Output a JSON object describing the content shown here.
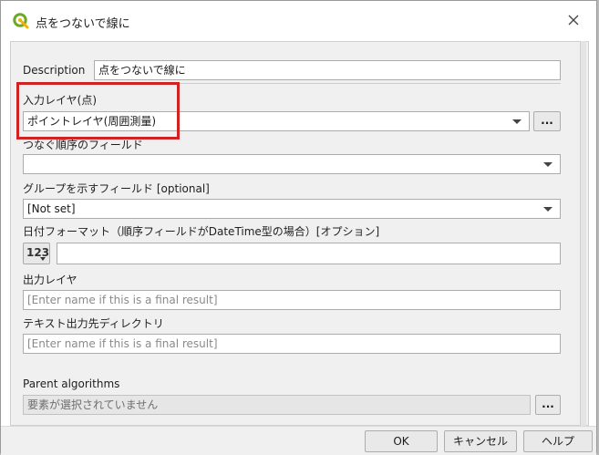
{
  "window": {
    "title": "点をつないで線に",
    "icon": "qgis-logo-icon",
    "close_icon": "close-icon"
  },
  "form": {
    "description": {
      "label": "Description",
      "value": "点をつないで線に"
    },
    "input_layer": {
      "label": "入力レイヤ(点)",
      "value": "ポイントレイヤ(周囲測量)",
      "browse": "..."
    },
    "order_field": {
      "label": "つなぐ順序のフィールド",
      "value": ""
    },
    "group_field": {
      "label": "グループを示すフィールド [optional]",
      "value": "[Not set]"
    },
    "date_format": {
      "label": "日付フォーマット（順序フィールドがDateTime型の場合）[オプション]",
      "value": "",
      "icon_text": "123"
    },
    "output_layer": {
      "label": "出力レイヤ",
      "placeholder": "[Enter name if this is a final result]"
    },
    "text_output_dir": {
      "label": "テキスト出力先ディレクトリ",
      "placeholder": "[Enter name if this is a final result]"
    },
    "parent_algorithms": {
      "label": "Parent algorithms",
      "value": "要素が選択されていません",
      "browse": "..."
    }
  },
  "footer": {
    "ok": "OK",
    "cancel": "キャンセル",
    "help": "ヘルプ"
  },
  "colors": {
    "highlight": "#cf2323",
    "panel": "#f0f0f0"
  }
}
